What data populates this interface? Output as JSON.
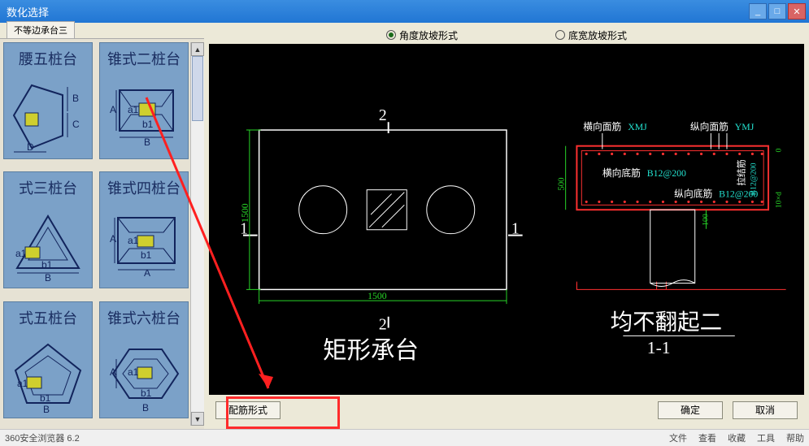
{
  "window": {
    "title": "数化选择",
    "min_label": "_",
    "max_label": "□",
    "close_label": "✕"
  },
  "tabs": {
    "active": "不等边承台三"
  },
  "radios": {
    "opt1": "角度放坡形式",
    "opt2": "底宽放坡形式",
    "selected": 0
  },
  "thumbnails": [
    {
      "caption": "腰五桩台"
    },
    {
      "caption": "锥式二桩台"
    },
    {
      "caption": "式三桩台"
    },
    {
      "caption": "锥式四桩台"
    },
    {
      "caption": "式五桩台"
    },
    {
      "caption": "锥式六桩台"
    }
  ],
  "buttons": {
    "rebar": "配筋形式",
    "ok": "确定",
    "cancel": "取消"
  },
  "statusbar": {
    "browser": "360安全浏览器 6.2",
    "items": [
      "文件",
      "查看",
      "收藏",
      "工具",
      "帮助"
    ]
  },
  "chart_data": {
    "type": "diagram",
    "left_view": {
      "title": "矩形承台",
      "width_mm": 1500,
      "height_mm": 1500,
      "section_marks": [
        "1",
        "2"
      ]
    },
    "right_view": {
      "title": "均不翻起二",
      "subtitle": "1-1",
      "height_mm": 500,
      "cover_mm": 100,
      "dim_flag_0": "0",
      "dim_flag_10xd": "10×d",
      "labels": {
        "hx_face": "横向面筋",
        "hx_face_code": "XMJ",
        "zx_face": "纵向面筋",
        "zx_face_code": "YMJ",
        "hx_bot": "横向底筋",
        "hx_bot_code": "B12@200",
        "zx_bot": "纵向底筋",
        "zx_bot_code": "B12@200",
        "side_label": "拉结筋",
        "side_code": "B12@200"
      }
    }
  }
}
